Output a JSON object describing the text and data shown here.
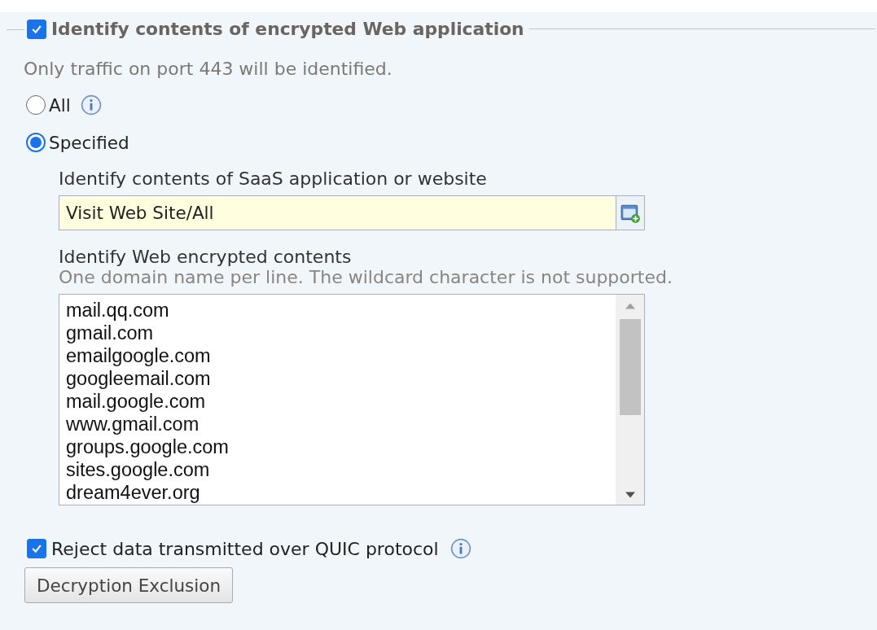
{
  "section": {
    "title": "Identify contents of encrypted Web application",
    "checked": true
  },
  "note": "Only traffic on port 443 will be identified.",
  "scope_options": [
    {
      "label": "All",
      "selected": false,
      "info": true
    },
    {
      "label": "Specified",
      "selected": true,
      "info": false
    }
  ],
  "saas": {
    "label": "Identify contents of SaaS application or website",
    "value": "Visit Web Site/All"
  },
  "encrypted_contents": {
    "label": "Identify Web encrypted contents",
    "hint": "One domain name per line. The wildcard character is not supported.",
    "lines": [
      "mail.qq.com",
      "gmail.com",
      "emailgoogle.com",
      "googleemail.com",
      "mail.google.com",
      "www.gmail.com",
      "groups.google.com",
      "sites.google.com",
      "dream4ever.org"
    ]
  },
  "reject_quic": {
    "label": "Reject data transmitted over QUIC protocol",
    "checked": true
  },
  "buttons": [
    "Decryption Exclusion"
  ]
}
